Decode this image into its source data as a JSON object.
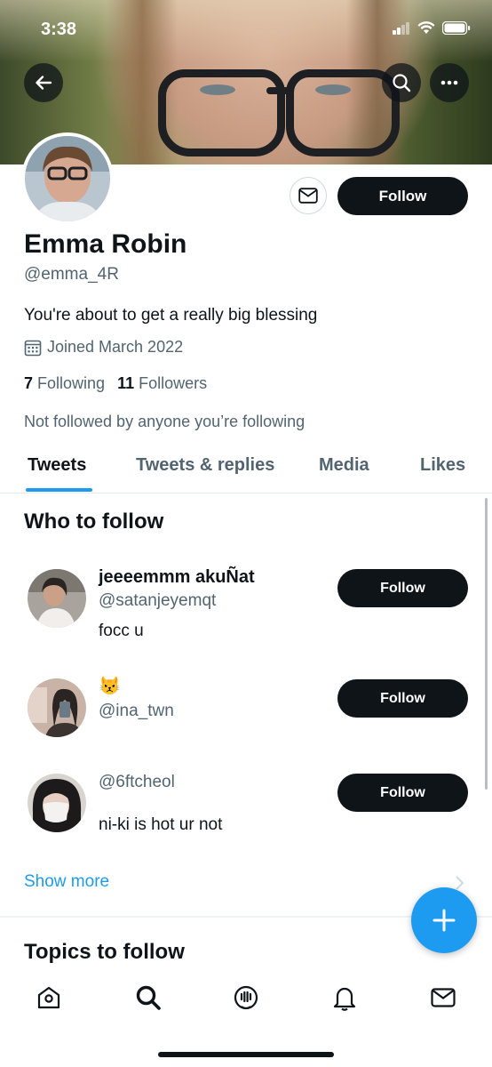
{
  "status_bar": {
    "time": "3:38"
  },
  "profile": {
    "display_name": "Emma Robin",
    "handle": "@emma_4R",
    "bio": "You're about to get a really big blessing",
    "joined": "Joined March 2022",
    "following_count": "7",
    "following_label": "Following",
    "followers_count": "11",
    "followers_label": "Followers",
    "not_followed_note": "Not followed by anyone you’re following",
    "follow_button": "Follow"
  },
  "tabs": [
    {
      "label": "Tweets",
      "active": true
    },
    {
      "label": "Tweets & replies",
      "active": false
    },
    {
      "label": "Media",
      "active": false
    },
    {
      "label": "Likes",
      "active": false
    }
  ],
  "who_to_follow": {
    "title": "Who to follow",
    "items": [
      {
        "name": "jeeeemmm akuÑat",
        "handle": "@satanjeyemqt",
        "bio": "focc u",
        "button": "Follow"
      },
      {
        "name": "😾",
        "handle": "@ina_twn",
        "bio": "",
        "button": "Follow"
      },
      {
        "name": "",
        "handle": "@6ftcheol",
        "bio": "ni-ki is hot ur not",
        "button": "Follow"
      }
    ],
    "show_more": "Show more"
  },
  "topics": {
    "title": "Topics to follow"
  },
  "icons": {
    "back": "back-arrow-icon",
    "search": "search-icon",
    "more": "more-icon",
    "message": "mail-icon",
    "calendar": "calendar-icon",
    "compose": "plus-icon",
    "nav": [
      "home-icon",
      "search-icon",
      "spaces-icon",
      "notifications-icon",
      "messages-icon"
    ]
  },
  "colors": {
    "accent": "#1d9bf0",
    "text": "#0f1419",
    "secondary_text": "#536471",
    "button_dark": "#0f1419"
  }
}
